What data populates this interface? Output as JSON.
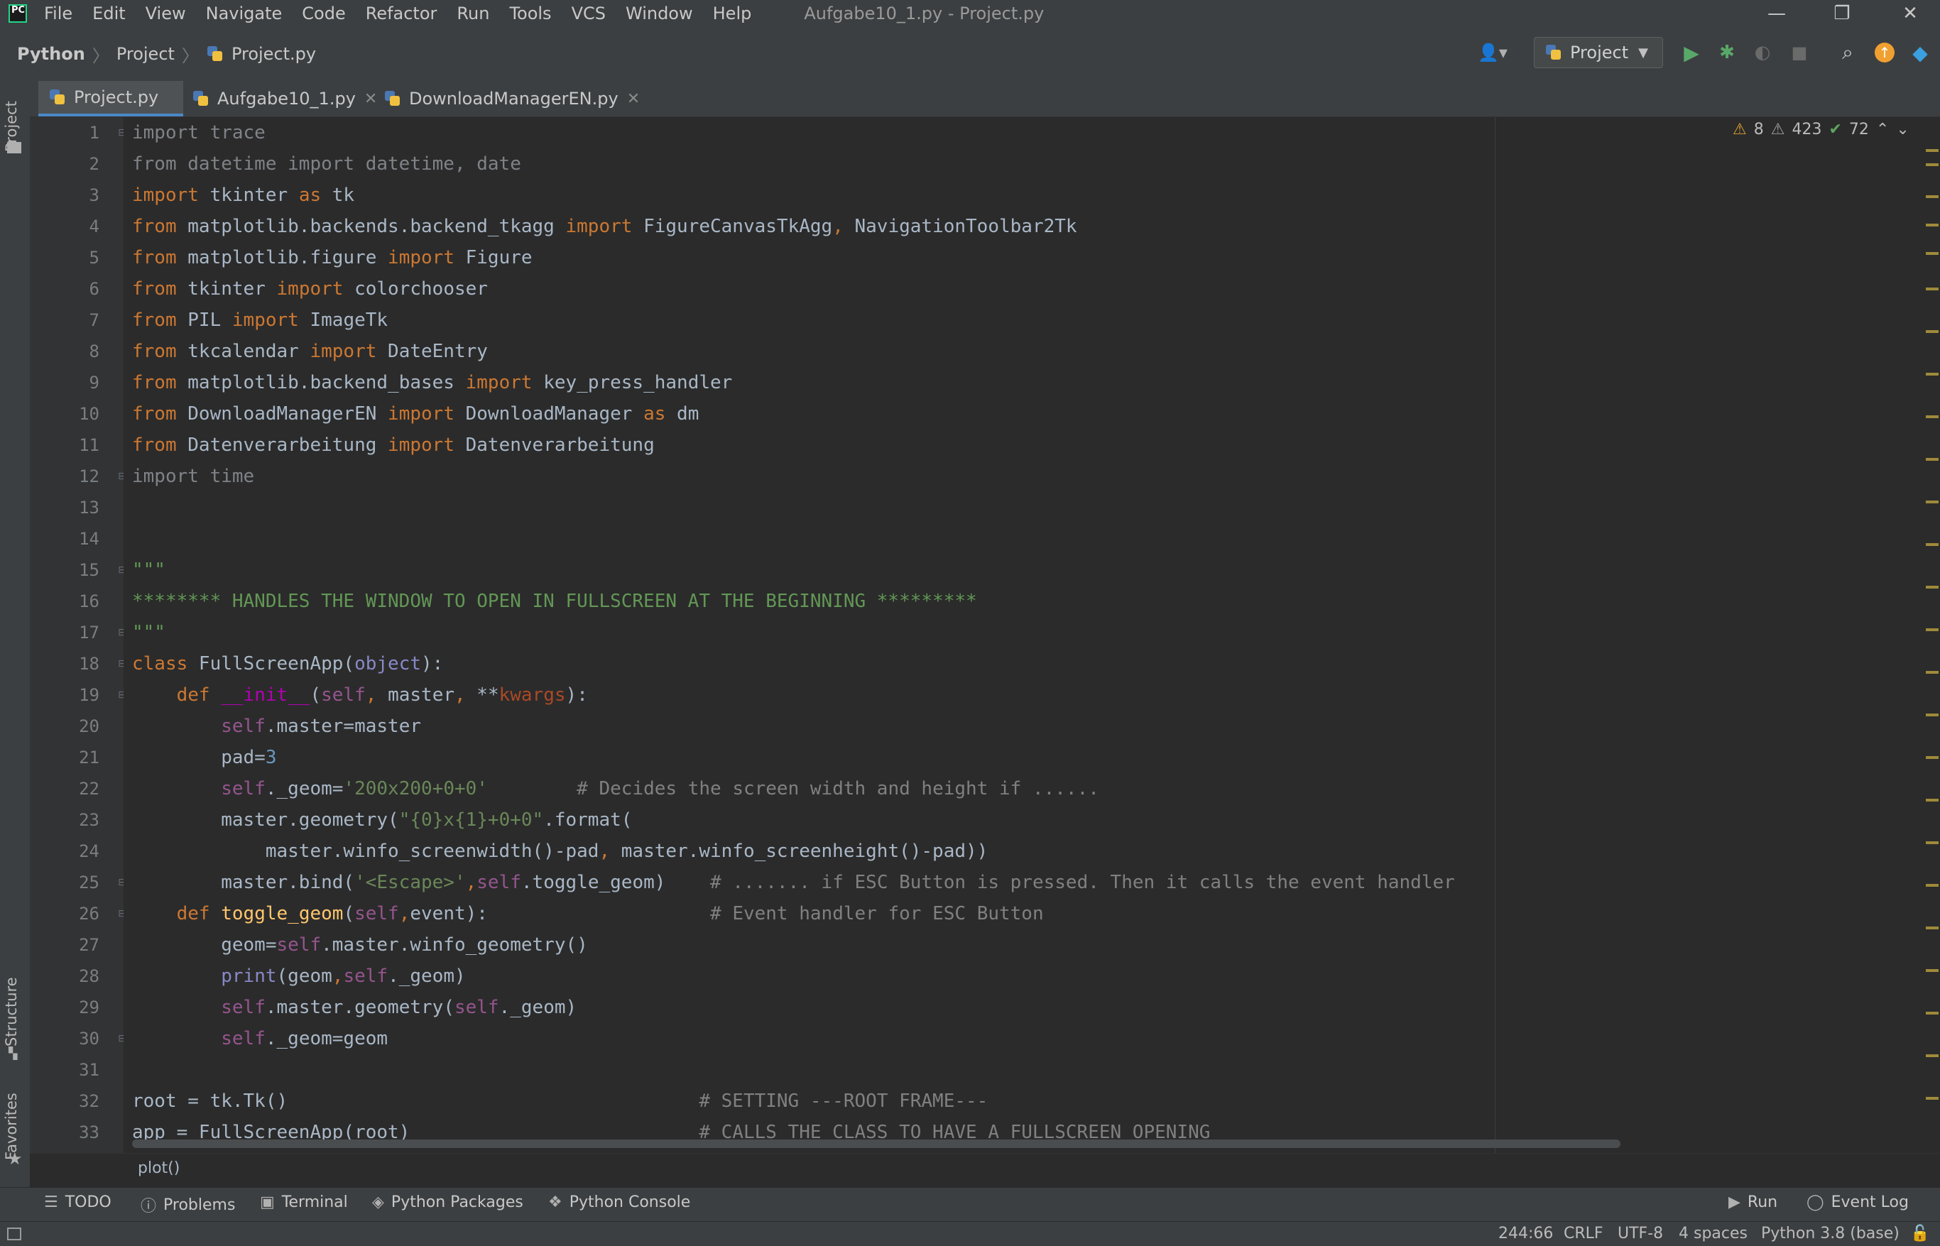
{
  "menubar": {
    "logo": "PC",
    "items": [
      "File",
      "Edit",
      "View",
      "Navigate",
      "Code",
      "Refactor",
      "Run",
      "Tools",
      "VCS",
      "Window",
      "Help"
    ],
    "title": "Aufgabe10_1.py - Project.py",
    "minimize": "—",
    "restore": "❐",
    "close": "✕"
  },
  "navbar": {
    "crumbs": [
      "Python",
      "Project",
      "Project.py"
    ],
    "run_config": "Project",
    "icons": [
      "user-icon",
      "run-icon",
      "debug-icon",
      "coverage-icon",
      "stop-icon",
      "search-icon",
      "update-icon",
      "toolbox-icon"
    ]
  },
  "left_stripe": {
    "project_label": "Project",
    "structure_label": "Structure",
    "favorites_label": "Favorites"
  },
  "tabs": [
    {
      "label": "Project.py",
      "active": true
    },
    {
      "label": "Aufgabe10_1.py",
      "active": false
    },
    {
      "label": "DownloadManagerEN.py",
      "active": false
    }
  ],
  "inspections": {
    "warnings": "8",
    "weak_warnings": "423",
    "typos": "72"
  },
  "code_lines": [
    "import trace",
    "from datetime import datetime, date",
    "import tkinter as tk",
    "from matplotlib.backends.backend_tkagg import FigureCanvasTkAgg, NavigationToolbar2Tk",
    "from matplotlib.figure import Figure",
    "from tkinter import colorchooser",
    "from PIL import ImageTk",
    "from tkcalendar import DateEntry",
    "from matplotlib.backend_bases import key_press_handler",
    "from DownloadManagerEN import DownloadManager as dm",
    "from Datenverarbeitung import Datenverarbeitung",
    "import time",
    "",
    "",
    "\"\"\"",
    "******** HANDLES THE WINDOW TO OPEN IN FULLSCREEN AT THE BEGINNING *********",
    "\"\"\"",
    "class FullScreenApp(object):",
    "    def __init__(self, master, **kwargs):",
    "        self.master=master",
    "        pad=3",
    "        self._geom='200x200+0+0'        # Decides the screen width and height if ......",
    "        master.geometry(\"{0}x{1}+0+0\".format(",
    "            master.winfo_screenwidth()-pad, master.winfo_screenheight()-pad))",
    "        master.bind('<Escape>',self.toggle_geom)    # ....... if ESC Button is pressed. Then it calls the event handler",
    "    def toggle_geom(self,event):                    # Event handler for ESC Button",
    "        geom=self.master.winfo_geometry()",
    "        print(geom,self._geom)",
    "        self.master.geometry(self._geom)",
    "        self._geom=geom",
    "",
    "root = tk.Tk()                                     # SETTING ---ROOT FRAME---",
    "app = FullScreenApp(root)                          # CALLS THE CLASS TO HAVE A FULLSCREEN OPENING"
  ],
  "footer_breadcrumb": "plot()",
  "tool_windows": [
    "TODO",
    "Problems",
    "Terminal",
    "Python Packages",
    "Python Console",
    "Run",
    "Event Log"
  ],
  "statusbar": {
    "position": "244:66",
    "line_sep": "CRLF",
    "encoding": "UTF-8",
    "indent": "4 spaces",
    "interpreter": "Python 3.8 (base)"
  },
  "colors": {
    "keyword": "#cc7832",
    "string": "#6a8759",
    "comment": "#808080",
    "self": "#94558d",
    "function": "#ffc66d",
    "accent": "#4a88c7"
  }
}
